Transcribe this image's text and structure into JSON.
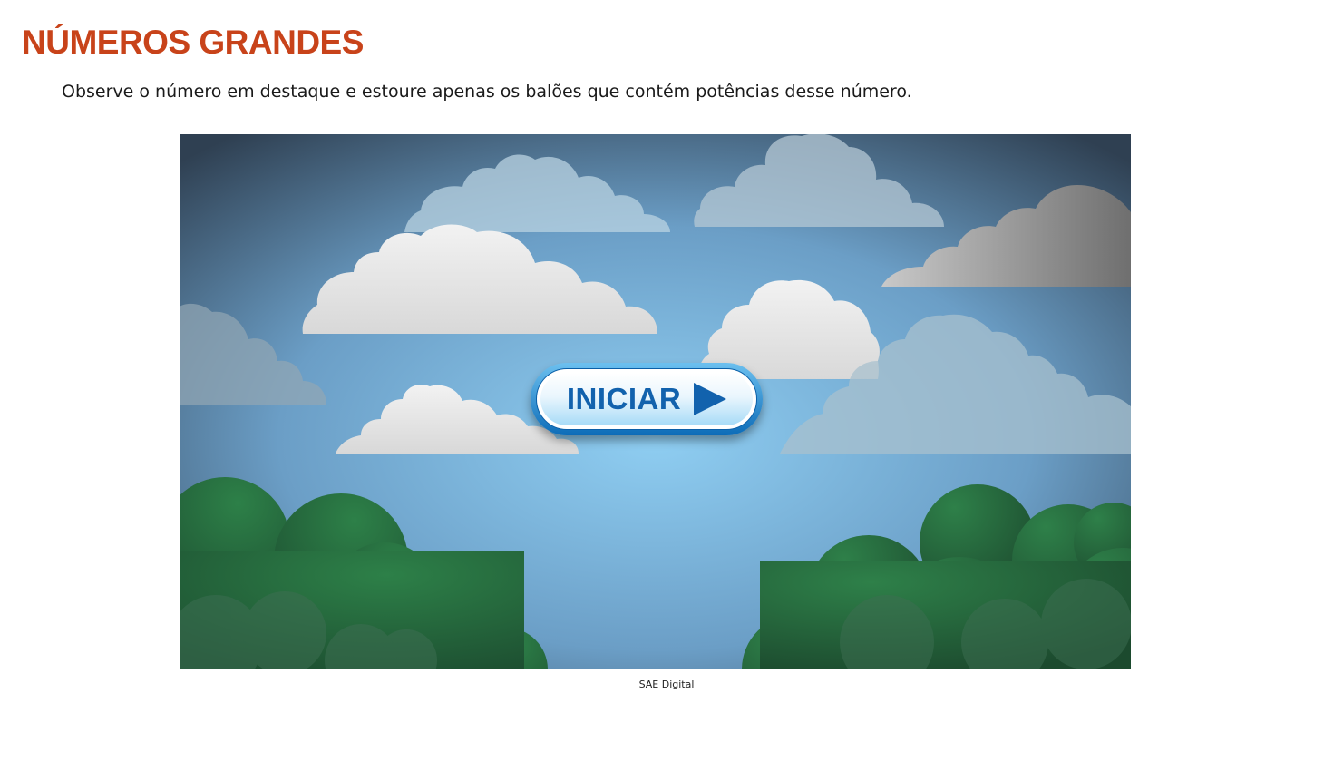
{
  "page": {
    "title": "NÚMEROS GRANDES",
    "instructions": "Observe o número em destaque e estoure apenas os balões que contém potências desse número.",
    "title_color": "#c8431a"
  },
  "game": {
    "start_button_label": "INICIAR",
    "start_button_icon": "play-icon",
    "sky_colors": [
      "#8fcdf1",
      "#5d8cb0",
      "#3b5068"
    ],
    "tree_color": "#2a7a45",
    "credit": "SAE Digital"
  }
}
